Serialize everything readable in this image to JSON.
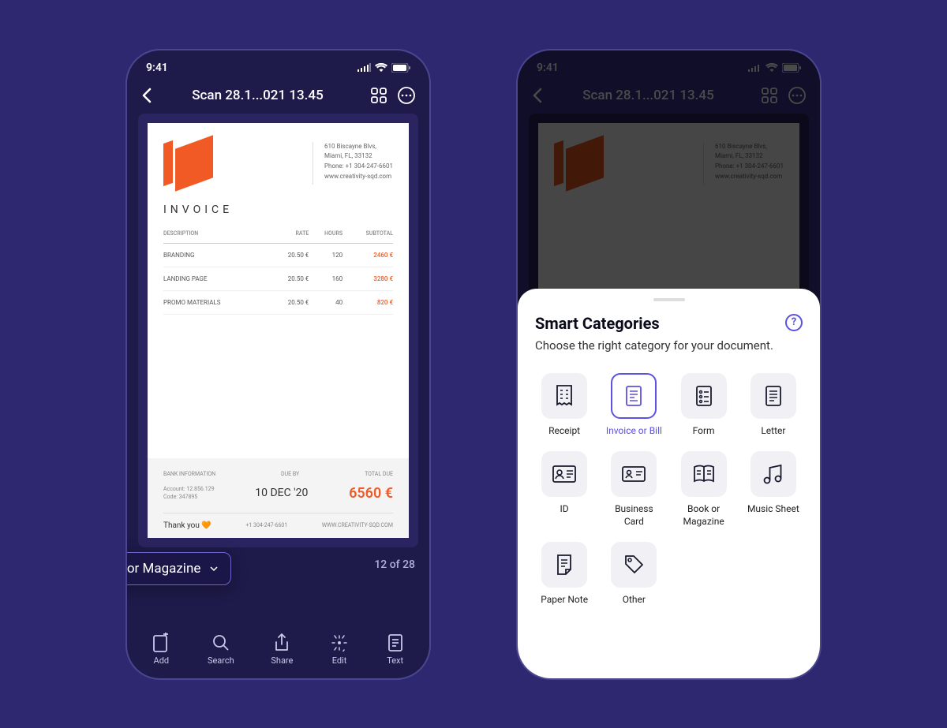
{
  "status": {
    "time": "9:41"
  },
  "nav": {
    "title": "Scan 28.1...021 13.45"
  },
  "invoice": {
    "title": "INVOICE",
    "company": {
      "address1": "610 Biscayne Blvs,",
      "address2": "Miami, FL, 33132",
      "phone": "Phone: +1 304-247-6601",
      "website": "www.creativity-sqd.com"
    },
    "headers": {
      "desc": "DESCRIPTION",
      "rate": "RATE",
      "hours": "HOURS",
      "subtotal": "SUBTOTAL"
    },
    "rows": [
      {
        "desc": "BRANDING",
        "rate": "20.50 €",
        "hours": "120",
        "subtotal": "2460 €"
      },
      {
        "desc": "LANDING PAGE",
        "rate": "20.50 €",
        "hours": "160",
        "subtotal": "3280 €"
      },
      {
        "desc": "PROMO MATERIALS",
        "rate": "20.50 €",
        "hours": "40",
        "subtotal": "820 €"
      }
    ],
    "footer": {
      "bank_label": "BANK INFORMATION",
      "due_label": "DUE BY",
      "total_label": "TOTAL DUE",
      "acct": "Account: 12.856.129",
      "code": "Code: 347895",
      "dueby": "10 DEC '20",
      "total": "6560 €",
      "thanks": "Thank you 🧡",
      "phone": "+1 304-247-6601",
      "web": "WWW.CREATIVITY-SQD.COM"
    }
  },
  "page_info": {
    "category_label": "Book or Magazine",
    "counter": "12 of 28"
  },
  "toolbar": {
    "add": "Add",
    "search": "Search",
    "share": "Share",
    "edit": "Edit",
    "text": "Text"
  },
  "sheet": {
    "title": "Smart Categories",
    "subtitle": "Choose the right category for your document.",
    "categories": {
      "receipt": "Receipt",
      "invoice": "Invoice or Bill",
      "form": "Form",
      "letter": "Letter",
      "id": "ID",
      "bcard": "Business Card",
      "book": "Book or Magazine",
      "music": "Music Sheet",
      "note": "Paper Note",
      "other": "Other"
    }
  }
}
